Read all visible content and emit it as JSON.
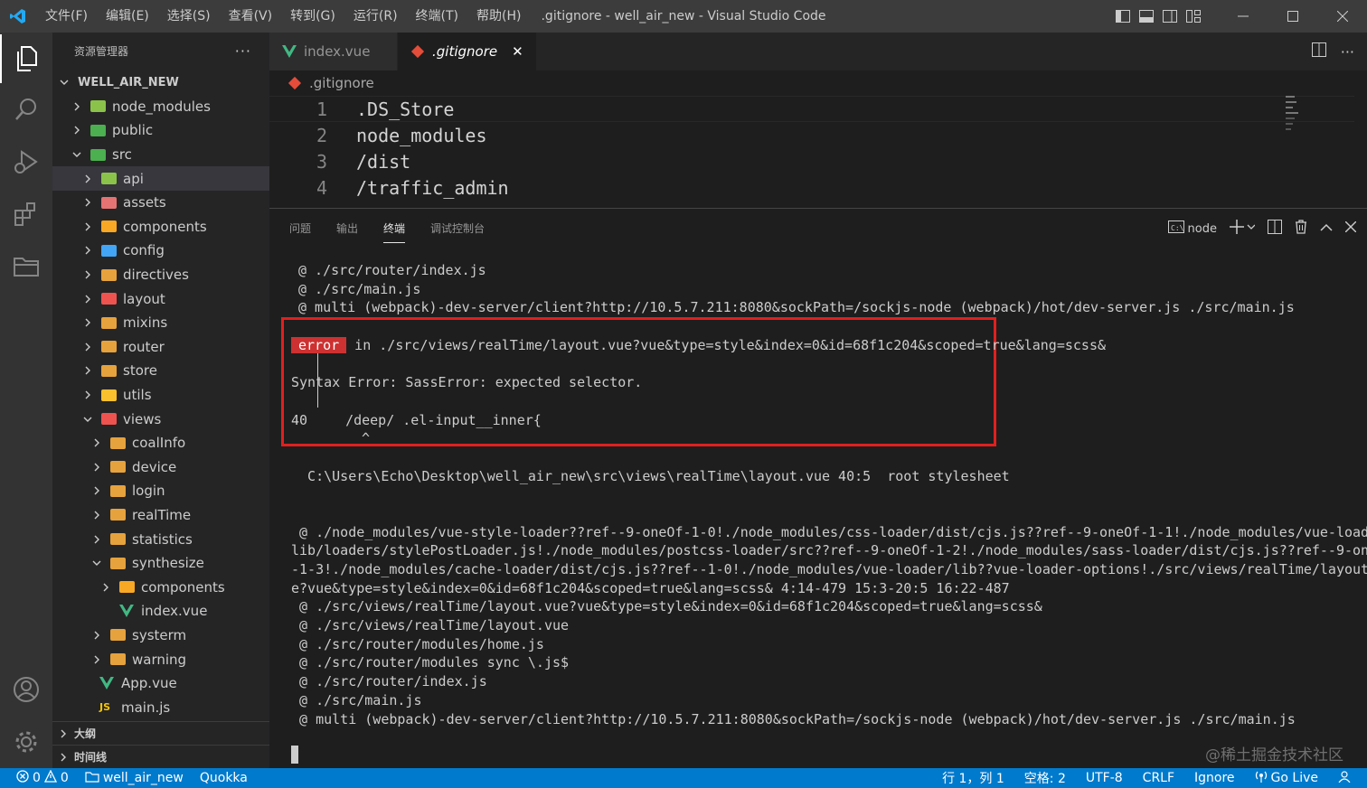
{
  "titlebar": {
    "menu": [
      "文件(F)",
      "编辑(E)",
      "选择(S)",
      "查看(V)",
      "转到(G)",
      "运行(R)",
      "终端(T)",
      "帮助(H)"
    ],
    "title": ".gitignore - well_air_new - Visual Studio Code"
  },
  "sidebar": {
    "header": "资源管理器",
    "more": "···",
    "root": "WELL_AIR_NEW",
    "items": [
      {
        "label": "node_modules"
      },
      {
        "label": "public"
      },
      {
        "label": "src"
      },
      {
        "label": "api"
      },
      {
        "label": "assets"
      },
      {
        "label": "components"
      },
      {
        "label": "config"
      },
      {
        "label": "directives"
      },
      {
        "label": "layout"
      },
      {
        "label": "mixins"
      },
      {
        "label": "router"
      },
      {
        "label": "store"
      },
      {
        "label": "utils"
      },
      {
        "label": "views"
      },
      {
        "label": "coalInfo"
      },
      {
        "label": "device"
      },
      {
        "label": "login"
      },
      {
        "label": "realTime"
      },
      {
        "label": "statistics"
      },
      {
        "label": "synthesize"
      },
      {
        "label": "components"
      },
      {
        "label": "index.vue"
      },
      {
        "label": "systerm"
      },
      {
        "label": "warning"
      },
      {
        "label": "App.vue"
      },
      {
        "label": "main.js"
      }
    ],
    "outline": "大纲",
    "timeline": "时间线"
  },
  "editor": {
    "tabs": [
      {
        "label": "index.vue"
      },
      {
        "label": ".gitignore",
        "close": "✕"
      }
    ],
    "breadcrumb": ".gitignore",
    "lines": [
      {
        "num": "1",
        "text": ".DS_Store"
      },
      {
        "num": "2",
        "text": "node_modules"
      },
      {
        "num": "3",
        "text": "/dist"
      },
      {
        "num": "4",
        "text": "/traffic_admin"
      }
    ]
  },
  "panel": {
    "tabs": [
      "问题",
      "输出",
      "终端",
      "调试控制台"
    ],
    "terminal_name": "node",
    "terminal": {
      "l1": "@ ./src/router/index.js",
      "l2": "@ ./src/main.js",
      "l3": "@ multi (webpack)-dev-server/client?http://10.5.7.211:8080&sockPath=/sockjs-node (webpack)/hot/dev-server.js ./src/main.js",
      "error_badge": "error",
      "error_in": " in ./src/views/realTime/layout.vue?vue&type=style&index=0&id=68f1c204&scoped=true&lang=scss&",
      "syntax": "Syntax Error: SassError: expected selector.",
      "line_no": "40",
      "code": "/deep/ .el-input__inner{",
      "caret": "^",
      "path": "  C:\\Users\\Echo\\Desktop\\well_air_new\\src\\views\\realTime\\layout.vue 40:5  root stylesheet",
      "w1": " @ ./node_modules/vue-style-loader??ref--9-oneOf-1-0!./node_modules/css-loader/dist/cjs.js??ref--9-oneOf-1-1!./node_modules/vue-loader/",
      "w2": "lib/loaders/stylePostLoader.js!./node_modules/postcss-loader/src??ref--9-oneOf-1-2!./node_modules/sass-loader/dist/cjs.js??ref--9-oneOf",
      "w3": "-1-3!./node_modules/cache-loader/dist/cjs.js??ref--1-0!./node_modules/vue-loader/lib??vue-loader-options!./src/views/realTime/layout.vu",
      "w4": "e?vue&type=style&index=0&id=68f1c204&scoped=true&lang=scss& 4:14-479 15:3-20:5 16:22-487",
      "s1": " @ ./src/views/realTime/layout.vue?vue&type=style&index=0&id=68f1c204&scoped=true&lang=scss&",
      "s2": " @ ./src/views/realTime/layout.vue",
      "s3": " @ ./src/router/modules/home.js",
      "s4": " @ ./src/router/modules sync \\.js$",
      "s5": " @ ./src/router/index.js",
      "s6": " @ ./src/main.js",
      "s7": " @ multi (webpack)-dev-server/client?http://10.5.7.211:8080&sockPath=/sockjs-node (webpack)/hot/dev-server.js ./src/main.js"
    },
    "watermark": "@稀土掘金技术社区"
  },
  "statusbar": {
    "errors": "0",
    "warnings": "0",
    "folder": "well_air_new",
    "quokka": "Quokka",
    "position": "行 1，列 1",
    "spaces": "空格: 2",
    "encoding": "UTF-8",
    "eol": "CRLF",
    "language": "Ignore",
    "golive": "Go Live"
  }
}
